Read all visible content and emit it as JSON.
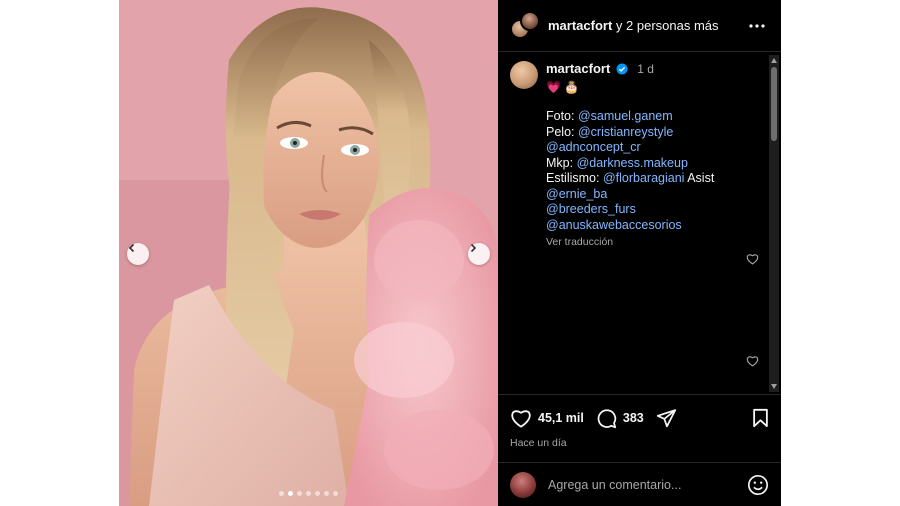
{
  "header": {
    "username": "martacfort",
    "collab_text": "y 2 personas más",
    "more_icon": "more-horizontal-icon"
  },
  "caption": {
    "username": "martacfort",
    "time": "1 d",
    "emojis": "💗 🎂",
    "lines": [
      {
        "label": "Foto: ",
        "mentions": [
          "@samuel.ganem"
        ]
      },
      {
        "label": "Pelo: ",
        "mentions": [
          "@cristianreystyle",
          "@adnconcept_cr"
        ]
      },
      {
        "label": "Mkp: ",
        "mentions": [
          "@darkness.makeup"
        ]
      },
      {
        "label": "Estilismo: ",
        "mentions": [
          "@florbaragiani"
        ],
        "suffix": " Asist"
      },
      {
        "label": "",
        "mentions": [
          "@ernie_ba"
        ]
      },
      {
        "label": "",
        "mentions": [
          "@breeders_furs",
          "@anuskawebaccesorios"
        ]
      }
    ],
    "translate": "Ver traducción"
  },
  "actions": {
    "likes": "45,1 mil",
    "comments": "383",
    "time_ago": "Hace un día"
  },
  "comment_box": {
    "placeholder": "Agrega un comentario..."
  },
  "carousel": {
    "total_slides": 7,
    "active_index": 1
  },
  "colors": {
    "panel_bg": "#000000",
    "link": "#82b7ff",
    "muted": "#a8a8a8",
    "verified": "#0095f6",
    "photo_bg": "#dc9aa2"
  }
}
